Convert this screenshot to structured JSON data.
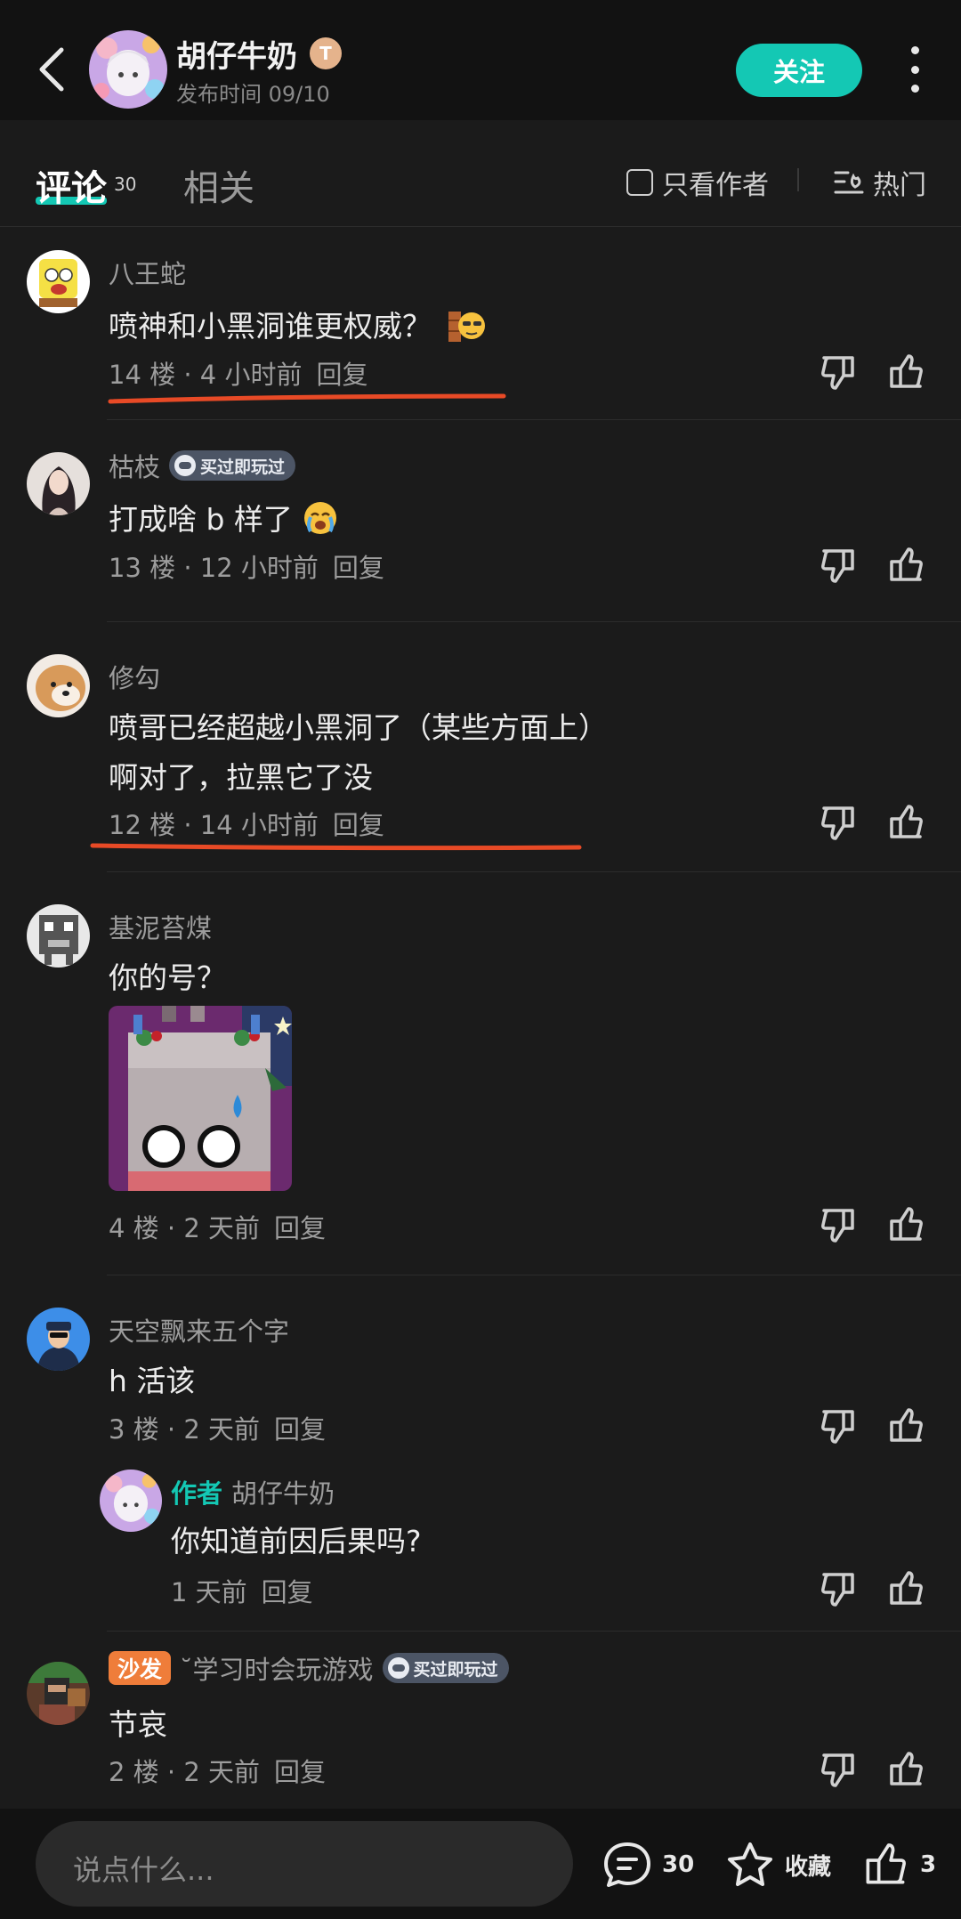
{
  "header": {
    "author_name": "胡仔牛奶",
    "level_badge": "T",
    "publish_time": "发布时间 09/10",
    "follow_label": "关注"
  },
  "tabs": {
    "comments_label": "评论",
    "comments_count": "30",
    "related_label": "相关",
    "author_only_label": "只看作者",
    "sort_label": "热门"
  },
  "comments": [
    {
      "author": "八王蛇",
      "text": "喷神和小黑洞谁更权威？",
      "floor": "14 楼 · 4 小时前",
      "reply": "回复"
    },
    {
      "author": "枯枝",
      "badge": "买过即玩过",
      "text": "打成啥 b 样了",
      "floor": "13 楼 · 12 小时前",
      "reply": "回复"
    },
    {
      "author": "修勾",
      "text_lines": [
        "喷哥已经超越小黑洞了（某些方面上）",
        "啊对了，拉黑它了没"
      ],
      "floor": "12 楼 · 14 小时前",
      "reply": "回复"
    },
    {
      "author": "基泥苔煤",
      "text": "你的号？",
      "floor": "4 楼 · 2 天前",
      "reply": "回复"
    },
    {
      "author": "天空飘来五个字",
      "text": "h 活该",
      "floor": "3 楼 · 2 天前",
      "reply": "回复"
    },
    {
      "author_tag": "作者",
      "author": "胡仔牛奶",
      "text": "你知道前因后果吗?",
      "floor": "1 天前",
      "reply": "回复"
    },
    {
      "sofa": "沙发",
      "author": "˘学习时会玩游戏",
      "badge": "买过即玩过",
      "text": "节哀",
      "floor": "2 楼 · 2 天前",
      "reply": "回复"
    }
  ],
  "bottom": {
    "input_placeholder": "说点什么...",
    "comment_count": "30",
    "favorite_label": "收藏",
    "like_count": "3"
  },
  "colors": {
    "accent": "#14c8b4",
    "annotation": "#e84a26",
    "sofa": "#ef7d3a"
  }
}
